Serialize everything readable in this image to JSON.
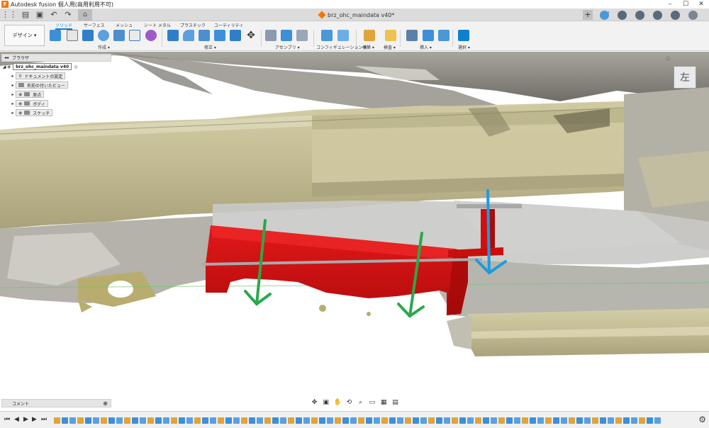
{
  "app": {
    "title": "Autodesk fusion 個人用(商用利用不可)",
    "logo_letter": "F"
  },
  "window_controls": {
    "minimize": "–",
    "maximize": "☐",
    "close": "✕"
  },
  "quick_access": {
    "grid_icon": "⋮⋮",
    "file_icon": "▤",
    "save_icon": "▣",
    "undo_icon": "↶",
    "redo_icon": "↷",
    "home_icon": "⌂"
  },
  "document": {
    "name": "brz_ohc_maindata v40*",
    "close_icon": "✕"
  },
  "right_toolbar": {
    "add_icon": "+"
  },
  "ribbon": {
    "workspace_label": "デザイン ▾",
    "tabs": [
      "ソリッド",
      "サーフェス",
      "メッシュ",
      "シート メタル",
      "プラスチック",
      "ユーティリティ"
    ],
    "groups": [
      "作成 ▾",
      "修正 ▾",
      "アセンブリ ▾",
      "コンフィギュレーション ▾",
      "構築 ▾",
      "検査 ▾",
      "挿入 ▾",
      "選択 ▾"
    ]
  },
  "browser": {
    "header": "ブラウザ",
    "collapse_icon": "◂◂",
    "root": "brz_ohc_maindata v40",
    "items": [
      "ドキュメントの設定",
      "名前の付いたビュー",
      "原点",
      "ボディ",
      "スケッチ"
    ]
  },
  "viewcube": {
    "face_label": "左",
    "home_icon": "⌂"
  },
  "comments": {
    "label": "コメント",
    "add_icon": "⊕"
  },
  "nav_bar": {
    "icons": [
      "✥",
      "▣",
      "✋",
      "⟲",
      "⌕",
      "▭",
      "▦",
      "▤"
    ]
  },
  "timeline": {
    "controls": [
      "⏮",
      "◀",
      "▶",
      "▶",
      "⏭"
    ],
    "gear_icon": "⚙"
  },
  "colors": {
    "accent": "#0f7fd2",
    "bracket_red": "#d40f0f",
    "arrow_green": "#2aa84a",
    "arrow_blue": "#1e9be0",
    "scan_tan": "#c9c29a",
    "scan_gray": "#9e9c93"
  }
}
